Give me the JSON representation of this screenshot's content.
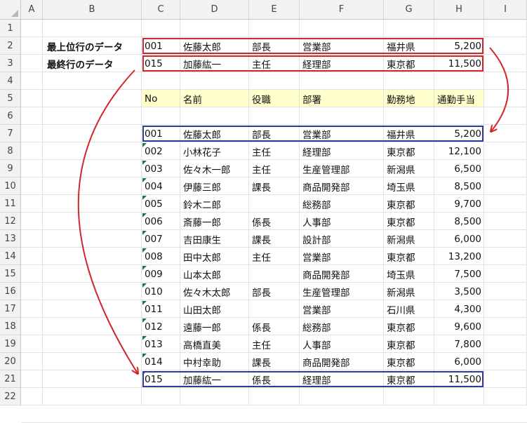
{
  "columns": [
    "A",
    "B",
    "C",
    "D",
    "E",
    "F",
    "G",
    "H",
    "I"
  ],
  "rows": [
    "1",
    "2",
    "3",
    "4",
    "5",
    "6",
    "7",
    "8",
    "9",
    "10",
    "11",
    "12",
    "13",
    "14",
    "15",
    "16",
    "17",
    "18",
    "19",
    "20",
    "21",
    "22"
  ],
  "labels": {
    "top_row": "最上位行のデータ",
    "last_row": "最終行のデータ"
  },
  "top_record": [
    "001",
    "佐藤太郎",
    "部長",
    "営業部",
    "福井県",
    "5,200"
  ],
  "last_record": [
    "015",
    "加藤紘一",
    "主任",
    "経理部",
    "東京都",
    "11,500"
  ],
  "table": {
    "headers": [
      "No",
      "名前",
      "役職",
      "部署",
      "勤務地",
      "通勤手当"
    ],
    "rows": [
      [
        "001",
        "佐藤太郎",
        "部長",
        "営業部",
        "福井県",
        "5,200"
      ],
      [
        "002",
        "小林花子",
        "主任",
        "経理部",
        "東京都",
        "12,100"
      ],
      [
        "003",
        "佐々木一郎",
        "主任",
        "生産管理部",
        "新潟県",
        "6,500"
      ],
      [
        "004",
        "伊藤三郎",
        "課長",
        "商品開発部",
        "埼玉県",
        "8,500"
      ],
      [
        "005",
        "鈴木二郎",
        "",
        "総務部",
        "東京都",
        "9,700"
      ],
      [
        "006",
        "斎藤一郎",
        "係長",
        "人事部",
        "東京都",
        "8,500"
      ],
      [
        "007",
        "吉田康生",
        "課長",
        "設計部",
        "新潟県",
        "6,000"
      ],
      [
        "008",
        "田中太郎",
        "主任",
        "営業部",
        "東京都",
        "13,200"
      ],
      [
        "009",
        "山本太郎",
        "",
        "商品開発部",
        "埼玉県",
        "7,500"
      ],
      [
        "010",
        "佐々木太郎",
        "部長",
        "生産管理部",
        "新潟県",
        "3,500"
      ],
      [
        "011",
        "山田太郎",
        "",
        "営業部",
        "石川県",
        "4,300"
      ],
      [
        "012",
        "遠藤一郎",
        "係長",
        "総務部",
        "東京都",
        "9,600"
      ],
      [
        "013",
        "高橋直美",
        "主任",
        "人事部",
        "東京都",
        "7,800"
      ],
      [
        "014",
        "中村幸助",
        "課長",
        "商品開発部",
        "東京都",
        "6,000"
      ],
      [
        "015",
        "加藤紘一",
        "係長",
        "経理部",
        "東京都",
        "11,500"
      ]
    ]
  },
  "colors": {
    "header_fill": "#ffffcc",
    "highlight_red": "#d0262d",
    "highlight_blue": "#2e3a9e",
    "number_as_text_marker": "#1e7a3a"
  }
}
